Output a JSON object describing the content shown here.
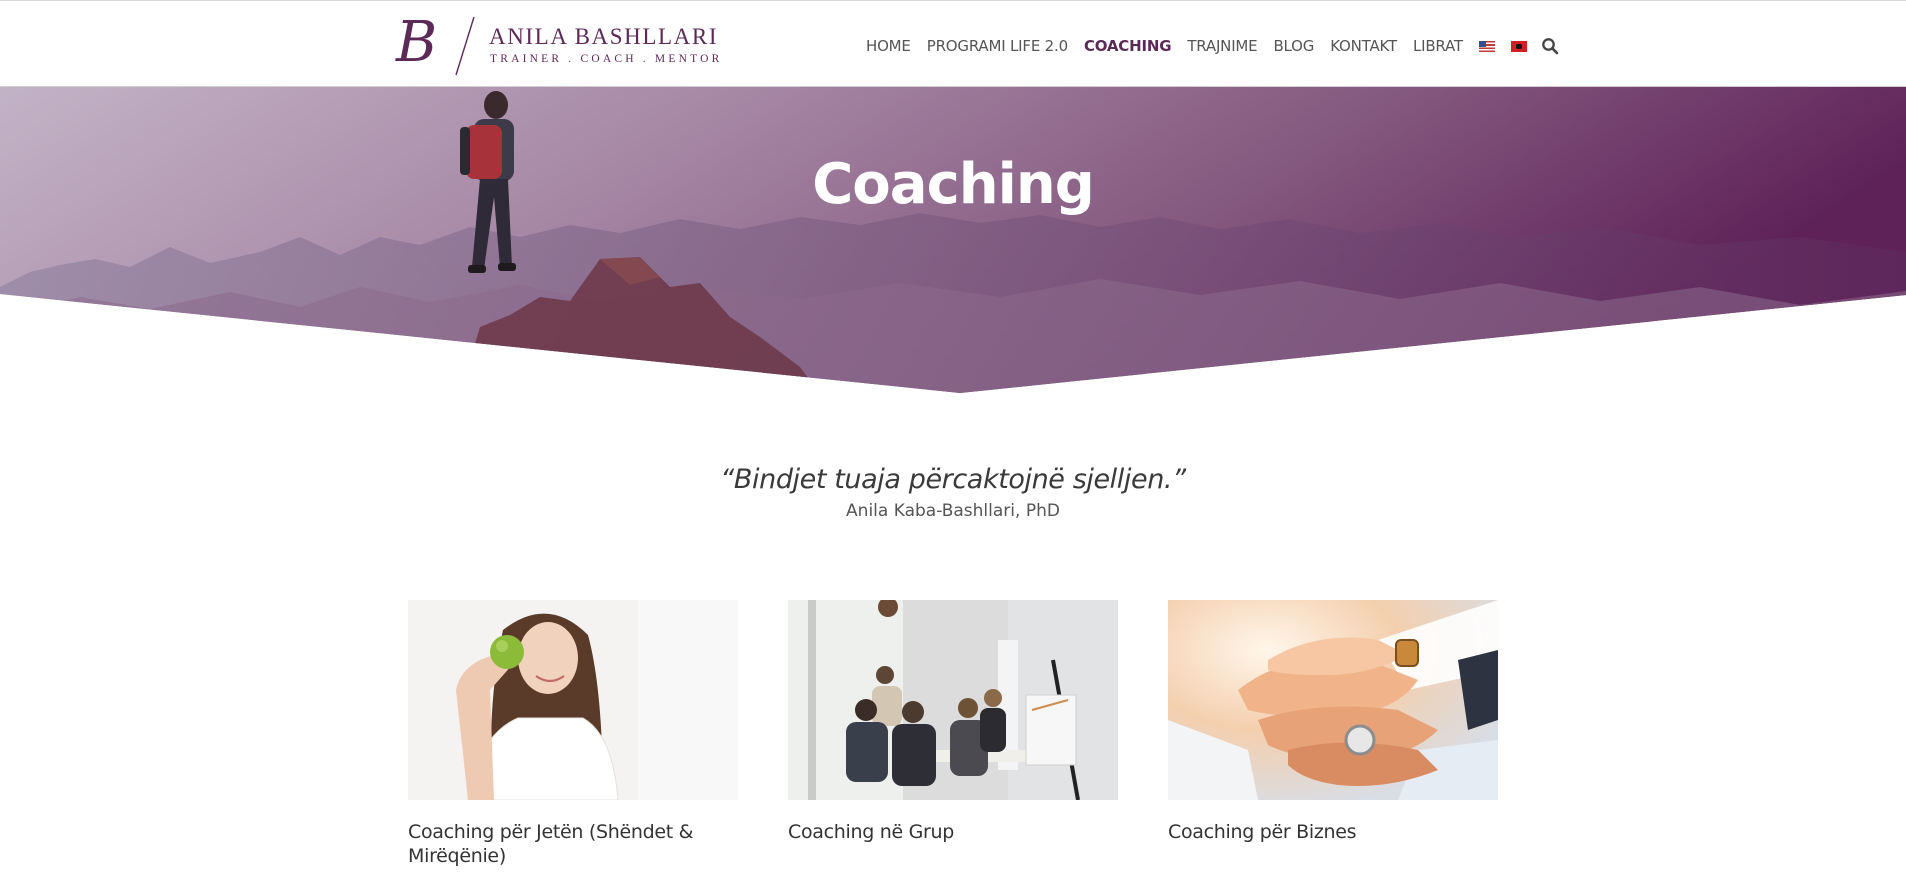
{
  "header": {
    "logo": {
      "name": "ANILA BASHLLARI",
      "tagline": "TRAINER . COACH . MENTOR"
    },
    "nav": [
      {
        "label": "HOME",
        "active": false
      },
      {
        "label": "PROGRAMI LIFE 2.0",
        "active": false
      },
      {
        "label": "COACHING",
        "active": true
      },
      {
        "label": "TRAJNIME",
        "active": false
      },
      {
        "label": "BLOG",
        "active": false
      },
      {
        "label": "KONTAKT",
        "active": false
      },
      {
        "label": "LIBRAT",
        "active": false
      }
    ],
    "flags": [
      "flag-us-icon",
      "flag-albania-icon"
    ],
    "search_icon": "search-icon"
  },
  "hero": {
    "title": "Coaching",
    "gradient_colors": [
      "#b8a2bf",
      "#5e2258"
    ]
  },
  "quote": {
    "text": "“Bindjet tuaja përcaktojnë sjelljen.”",
    "author": "Anila Kaba-Bashllari, PhD"
  },
  "cards": [
    {
      "title": "Coaching për Jetën (Shëndet & Mirëqënie)",
      "image": "woman-with-apple"
    },
    {
      "title": "Coaching në Grup",
      "image": "group-meeting"
    },
    {
      "title": "Coaching për Biznes",
      "image": "stacked-hands"
    }
  ],
  "colors": {
    "brand": "#5c2a57",
    "text": "#333333"
  }
}
